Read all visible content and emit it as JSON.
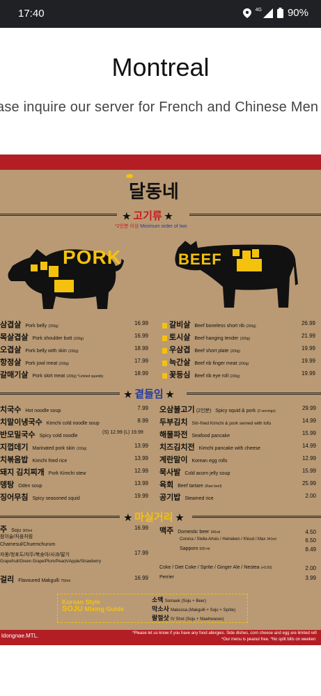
{
  "status": {
    "time": "17:40",
    "network": "4G",
    "battery": "90%"
  },
  "page": {
    "title": "Montreal",
    "subtitle": "ase inquire our server for French and Chinese Men"
  },
  "menu": {
    "brand": "달동네",
    "sections": {
      "meat": {
        "title": "고기류",
        "note_kr": "*2인분 이상",
        "note_en": "Minimum order of two"
      },
      "meals": {
        "title": "곁들임"
      },
      "drinks": {
        "title": "마실거리"
      }
    },
    "animals": {
      "pork": "PORK",
      "beef": "BEEF"
    },
    "pork_items": [
      {
        "kr": "삼겹살",
        "en": "Pork belly",
        "qty": "(200g)",
        "price": "16.99"
      },
      {
        "kr": "목살겹살",
        "en": "Pork shoulder butt",
        "qty": "(200g)",
        "price": "16.99"
      },
      {
        "kr": "오겹살",
        "en": "Pork belly with skin",
        "qty": "(200g)",
        "price": "18.99"
      },
      {
        "kr": "항정살",
        "en": "Pork jowl meat",
        "qty": "(200g)",
        "price": "17.99"
      },
      {
        "kr": "갈매기살",
        "en": "Pork skirt meat",
        "qty": "(200g) *Limited quantity",
        "price": "18.99"
      }
    ],
    "beef_items": [
      {
        "kr": "갈비살",
        "en": "Beef boneless short rib",
        "qty": "(200g)",
        "price": "26.99"
      },
      {
        "kr": "토시살",
        "en": "Beef hanging tender",
        "qty": "(200g)",
        "price": "21.99"
      },
      {
        "kr": "우삼겹",
        "en": "Beef short plate",
        "qty": "(200g)",
        "price": "19.99"
      },
      {
        "kr": "늑간살",
        "en": "Beef rib finger meat",
        "qty": "(200g)",
        "price": "19.99"
      },
      {
        "kr": "꽃등심",
        "en": "Beef rib eye roll",
        "qty": "(200g)",
        "price": "19.99"
      }
    ],
    "side_left": [
      {
        "kr": "치국수",
        "en": "Hot noodle soup",
        "price": "7.99"
      },
      {
        "kr": "치말이냉국수",
        "en": "Kimchi cold noodle soup",
        "price": "8.99"
      },
      {
        "kr": "반모밀국수",
        "en": "Spicy cold noodle",
        "extra": "(S) 12.99  (L) 19.99",
        "price": ""
      },
      {
        "kr": "지껍데기",
        "en": "Marinated pork skin",
        "qty": "(150g)",
        "price": "13.99"
      },
      {
        "kr": "치볶음밥",
        "en": "Kimchi fried rice",
        "price": "13.99"
      },
      {
        "kr": "돼지 김치찌개",
        "en": "Pork Kimchi stew",
        "price": "12.99"
      },
      {
        "kr": "뎅탕",
        "en": "Oden soup",
        "price": "13.99"
      },
      {
        "kr": "징어무침",
        "en": "Spicy seasoned squid",
        "price": "19.99"
      }
    ],
    "side_right": [
      {
        "kr": "오삼불고기",
        "kr2": "(2인분)",
        "en": "Spicy squid & pork",
        "qty": "(2 servings)",
        "price": "29.99"
      },
      {
        "kr": "두부김치",
        "en": "Stir-fried Kimchi & pork served with tofu",
        "price": "14.99"
      },
      {
        "kr": "해물파전",
        "en": "Seafood pancake",
        "price": "15.99"
      },
      {
        "kr": "치즈김치전",
        "en": "Kimchi pancake with cheese",
        "price": "14.99"
      },
      {
        "kr": "계란말이",
        "en": "Korean egg rolls",
        "price": "12.99"
      },
      {
        "kr": "묵사발",
        "en": "Cold acorn jelly soup",
        "price": "15.99"
      },
      {
        "kr": "육회",
        "en": "Beef tartare",
        "qty": "(Raw beef)",
        "price": "25.99"
      },
      {
        "kr": "공기밥",
        "en": "Steamed rice",
        "price": "2.00"
      }
    ],
    "drinks_left": {
      "soju_kr": "주",
      "soju_en": "Soju",
      "soju_qty": "360ml",
      "soju_price": "16.99",
      "soju_types": "참이슬/처음처럼",
      "flavored_names": "Chamesul/Chuemchurum",
      "flavored_kr": "자몽/청포도/자두/복숭아/사과/딸기",
      "flavored_en": "Grapefruit/Green Grape/Plum/Peach/Apple/Strawberry",
      "flavored_price": "17.99",
      "makgulli_kr": "걸리",
      "makgulli_en": "Flavoured Makgulli",
      "makgulli_qty": "750ml",
      "makgulli_price": "16.99"
    },
    "drinks_right": {
      "beer_kr": "맥주",
      "beer_en": "Domestic beer",
      "beer_qty": "341ml",
      "beer_price": "4.50",
      "import": "Corona / Stella Artois / Heineken / Kloud / Max",
      "import_qty": "341ml",
      "import_price": "6.50",
      "sapporo": "Sapporo",
      "sapporo_qty": "500 ml",
      "sapporo_price": "8.49",
      "soft": "Coke / Diet Coke / Sprite / Ginger Ale / Nestea",
      "soft_extra": "(+0.50)",
      "soft_price": "2.00",
      "perrier": "Perrier",
      "perrier_price": "3.99"
    },
    "soju_guide": {
      "title1": "Korean Style",
      "title2": "SOJU",
      "title3": "Mixing Guide",
      "rows": [
        {
          "kr": "소맥",
          "en": "Somaek (Soju + Beer)"
        },
        {
          "kr": "막소사",
          "en": "Maksosa (Makgulli + Soju + Sprite)"
        },
        {
          "kr": "랄절삿",
          "en": "IV Shot (Soju + Maehwasoo)"
        }
      ]
    },
    "footer": {
      "handle": "ldongnae.MTL.",
      "note1": "*Please let us know if you have any food allergies. Side dishes, corn cheese and egg are limited refi",
      "note2": "*Our menu is peanut free.  *No split bills on weeken"
    }
  }
}
